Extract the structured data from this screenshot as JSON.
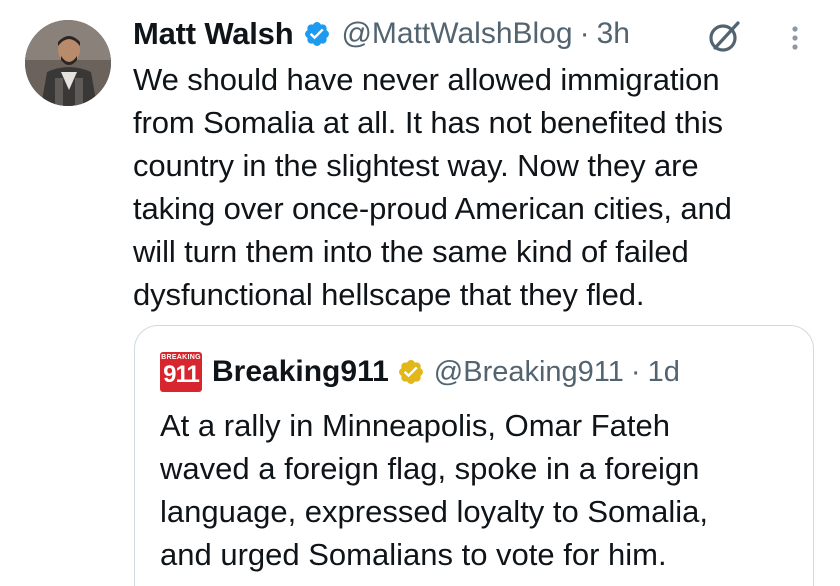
{
  "tweet": {
    "author_name": "Matt Walsh",
    "author_handle": "@MattWalshBlog",
    "separator": "·",
    "time": "3h",
    "body": "We should have never allowed immigration\nfrom Somalia at all. It has not benefited this\ncountry in the slightest way. Now they are\ntaking over once-proud American cities, and\nwill turn them into the same kind of failed\ndysfunctional hellscape that they fled.",
    "verified_color": "#1d9bf0",
    "avatar_icon": "user-avatar"
  },
  "quote": {
    "logo_top": "BREAKING",
    "logo_number": "911",
    "author_name": "Breaking911",
    "author_handle": "@Breaking911",
    "separator": "·",
    "time": "1d",
    "body": "At a rally in Minneapolis, Omar Fateh\nwaved a foreign flag, spoke in a foreign\nlanguage, expressed loyalty to Somalia,\nand urged Somalians to vote for him.",
    "verified_color": "#e2b719",
    "logo_color": "#d7262e"
  },
  "icons": {
    "grok": "grok-icon",
    "more": "more-options-icon"
  }
}
